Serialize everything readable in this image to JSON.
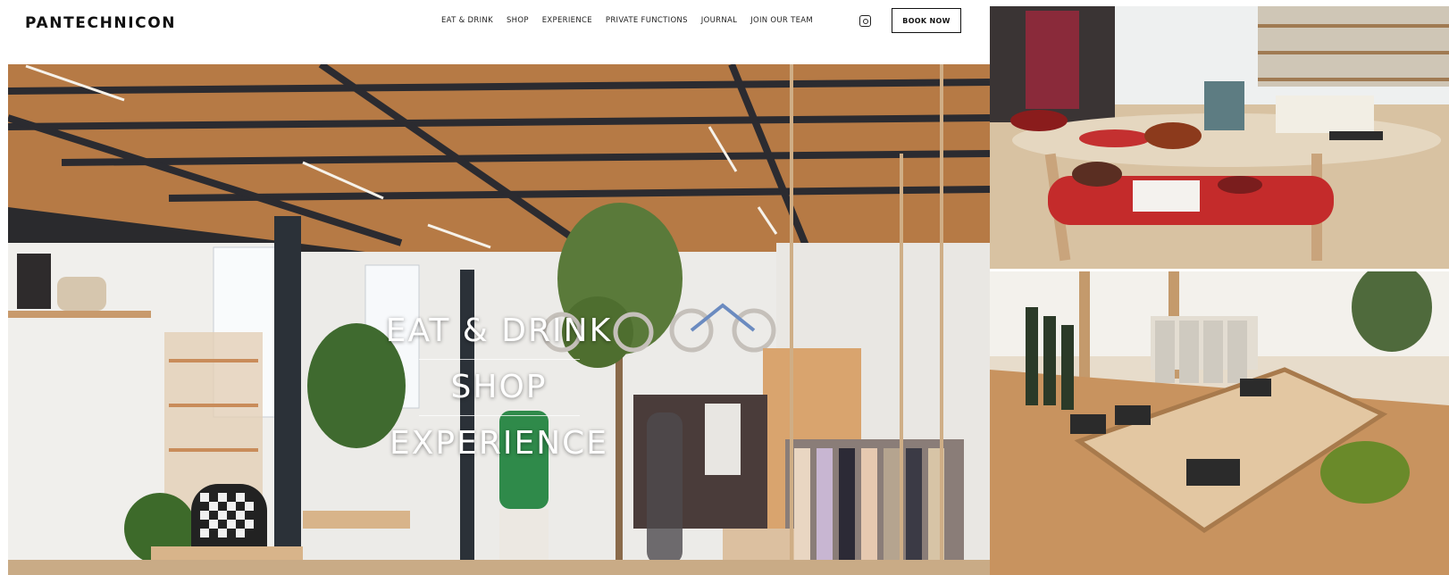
{
  "brand": {
    "name": "PANTECHNICON"
  },
  "nav": {
    "items": [
      "EAT & DRINK",
      "SHOP",
      "EXPERIENCE",
      "PRIVATE FUNCTIONS",
      "JOURNAL",
      "JOIN OUR TEAM"
    ],
    "social_icon": "instagram-icon",
    "cta": "BOOK NOW"
  },
  "hero": {
    "links": [
      "EAT & DRINK",
      "SHOP",
      "EXPERIENCE"
    ]
  },
  "colors": {
    "text": "#111111",
    "background": "#ffffff",
    "hero_text": "#ffffff"
  }
}
